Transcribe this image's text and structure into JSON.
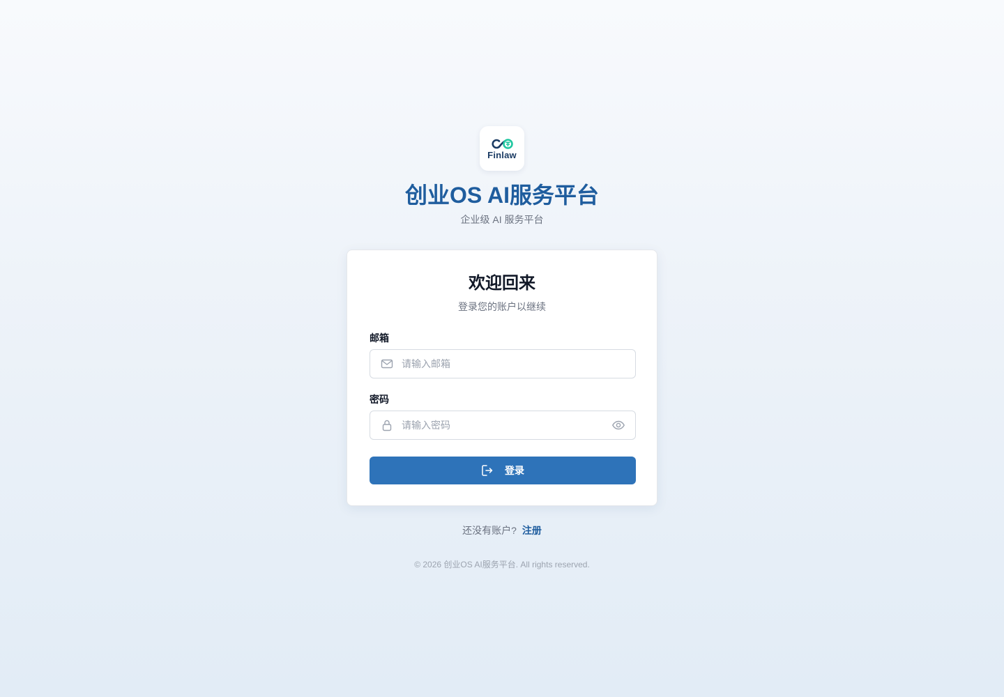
{
  "brand": {
    "logo_text": "Finlaw",
    "title": "创业OS AI服务平台",
    "subtitle": "企业级 AI 服务平台",
    "colors": {
      "primary": "#2e73b9",
      "title": "#1f5d9e",
      "logo_dark": "#1b3b63",
      "logo_accent": "#1fc7a0"
    }
  },
  "login_card": {
    "title": "欢迎回来",
    "subtitle": "登录您的账户以继续",
    "email": {
      "label": "邮箱",
      "placeholder": "请输入邮箱",
      "value": "",
      "icon": "mail-icon"
    },
    "password": {
      "label": "密码",
      "placeholder": "请输入密码",
      "value": "",
      "icon": "lock-icon",
      "toggle_icon": "eye-icon"
    },
    "submit": {
      "label": "登录",
      "icon": "login-icon"
    }
  },
  "register": {
    "prompt": "还没有账户?",
    "link_label": "注册"
  },
  "footer": {
    "copyright": "© 2026 创业OS AI服务平台. All rights reserved."
  }
}
